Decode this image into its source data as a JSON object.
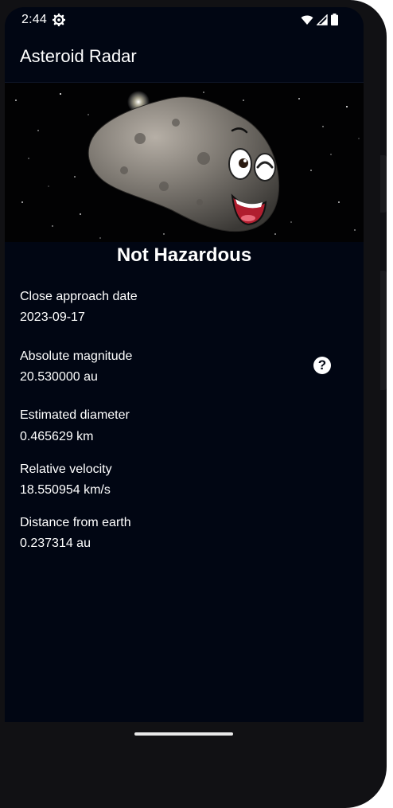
{
  "status_bar": {
    "time": "2:44",
    "icons": [
      "gear-icon",
      "wifi-icon",
      "signal-icon",
      "battery-icon"
    ]
  },
  "app_bar": {
    "title": "Asteroid Radar"
  },
  "hero": {
    "image": "asteroid-illustration"
  },
  "detail": {
    "hazard_status": "Not Hazardous",
    "fields": [
      {
        "label": "Close approach date",
        "value": "2023-09-17"
      },
      {
        "label": "Absolute magnitude",
        "value": "20.530000 au"
      },
      {
        "label": "Estimated diameter",
        "value": "0.465629 km"
      },
      {
        "label": "Relative velocity",
        "value": "18.550954 km/s"
      },
      {
        "label": "Distance from earth",
        "value": "0.237314 au"
      }
    ],
    "help_icon": "help-circle-icon",
    "help_glyph": "?"
  },
  "colors": {
    "background": "#010613",
    "text": "#ffffff"
  }
}
